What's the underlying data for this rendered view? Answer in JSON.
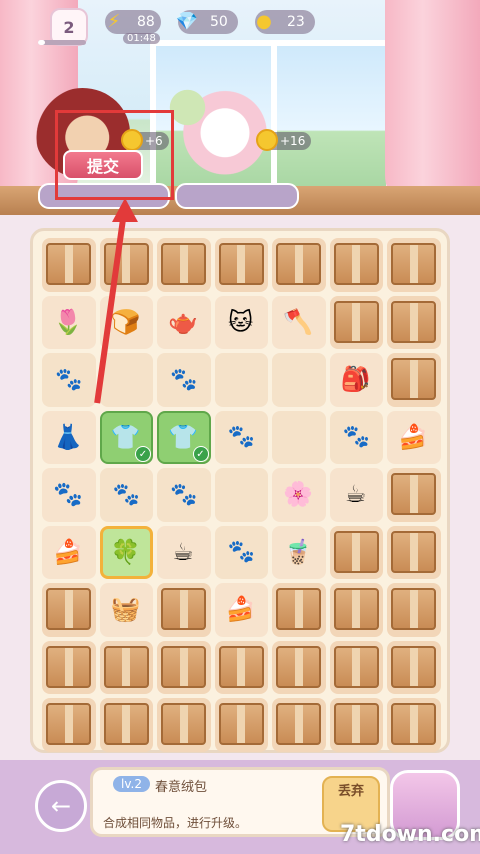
{
  "top_bar": {
    "level": "2",
    "energy": "88",
    "energy_timer": "01:48",
    "gems": "50",
    "coins": "23"
  },
  "orders": [
    {
      "reward": "+6",
      "submit_label": "提交"
    },
    {
      "reward": "+16"
    }
  ],
  "grid": {
    "rows": [
      [
        "box",
        "box",
        "box",
        "box",
        "box",
        "box",
        "box"
      ],
      [
        "tulip",
        "bread",
        "teapot",
        "cat",
        "shovel",
        "box",
        "box"
      ],
      [
        "paw",
        "empty",
        "paw",
        "empty",
        "empty",
        "sack",
        "box"
      ],
      [
        "dress",
        "shirt-sel",
        "shirt-sel",
        "paw",
        "empty",
        "paw",
        "cake"
      ],
      [
        "catbowl",
        "paw",
        "paw",
        "empty",
        "flower-frame",
        "teacup",
        "box"
      ],
      [
        "cake",
        "clover-hl",
        "teacup",
        "paw",
        "cake2",
        "box",
        "box"
      ],
      [
        "box",
        "basket",
        "box",
        "cake",
        "box",
        "box",
        "box"
      ],
      [
        "box",
        "box",
        "box",
        "box",
        "box",
        "box",
        "box"
      ],
      [
        "box",
        "box",
        "box",
        "box",
        "box",
        "box",
        "box"
      ]
    ]
  },
  "info": {
    "level_tag": "lv.2",
    "item_name": "春意绒包",
    "description": "合成相同物品，进行升级。",
    "discard_label": "丢弃"
  },
  "watermark": "7tdown.com"
}
